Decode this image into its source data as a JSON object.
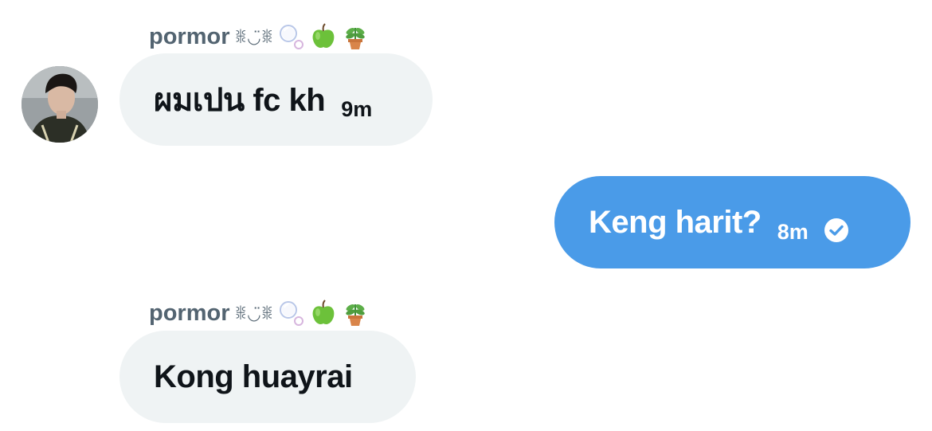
{
  "messages": [
    {
      "sender_name": "pormor",
      "sender_decoration": "ꒌ◡̈ꒌ",
      "sender_emojis": [
        "bubbles-icon",
        "green-apple-icon",
        "potted-plant-icon"
      ],
      "text": "ผมเปน fc kh",
      "time": "9m",
      "direction": "incoming"
    },
    {
      "text": "Keng harit?",
      "time": "8m",
      "status_icon": "check-circle-icon",
      "direction": "outgoing"
    },
    {
      "sender_name": "pormor",
      "sender_decoration": "ꒌ◡̈ꒌ",
      "sender_emojis": [
        "bubbles-icon",
        "green-apple-icon",
        "potted-plant-icon"
      ],
      "text": "Kong huayrai",
      "time": "",
      "direction": "incoming"
    }
  ],
  "colors": {
    "incoming_bubble": "#eff3f4",
    "outgoing_bubble": "#4a9be8",
    "sender_name": "#536471",
    "text_dark": "#0f1419"
  }
}
